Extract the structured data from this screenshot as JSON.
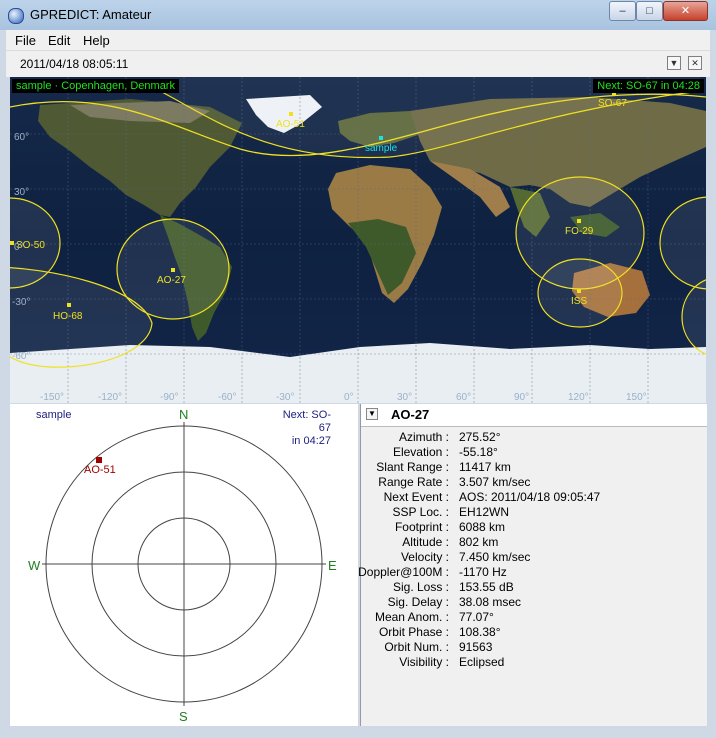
{
  "window": {
    "title": "GPREDICT: Amateur",
    "minimize": "–",
    "maximize": "□",
    "close": "✕"
  },
  "menu": [
    "File",
    "Edit",
    "Help"
  ],
  "timebar": {
    "datetime": "2011/04/18 08:05:11",
    "dropdown": "▼",
    "close": "✕"
  },
  "map": {
    "station_label": "sample · Copenhagen, Denmark",
    "next_label": "Next: SO-67 in 04:28",
    "station_name": "sample",
    "satellites": [
      "AO-51",
      "SO-67",
      "SO-50",
      "AO-27",
      "HO-68",
      "FO-29",
      "ISS"
    ],
    "lat_labels": [
      "60°",
      "30°",
      "0°",
      "-30°",
      "-60°"
    ],
    "lon_labels": [
      "-150°",
      "-120°",
      "-90°",
      "-60°",
      "-30°",
      "0°",
      "30°",
      "60°",
      "90°",
      "120°",
      "150°"
    ]
  },
  "polar": {
    "station": "sample",
    "next_line1": "Next: SO-67",
    "next_line2": "in 04:27",
    "north": "N",
    "south": "S",
    "east": "E",
    "west": "W",
    "sat_label": "AO-51"
  },
  "info": {
    "satellite": "AO-27",
    "rows": [
      {
        "k": "Azimuth :",
        "v": "275.52°"
      },
      {
        "k": "Elevation :",
        "v": "-55.18°"
      },
      {
        "k": "Slant Range :",
        "v": "11417 km"
      },
      {
        "k": "Range Rate :",
        "v": "3.507 km/sec"
      },
      {
        "k": "Next Event :",
        "v": "AOS: 2011/04/18 09:05:47"
      },
      {
        "k": "SSP Loc. :",
        "v": "EH12WN"
      },
      {
        "k": "Footprint :",
        "v": "6088 km"
      },
      {
        "k": "Altitude :",
        "v": "802 km"
      },
      {
        "k": "Velocity :",
        "v": "7.450 km/sec"
      },
      {
        "k": "Doppler@100M :",
        "v": "-1170 Hz"
      },
      {
        "k": "Sig. Loss :",
        "v": "153.55 dB"
      },
      {
        "k": "Sig. Delay :",
        "v": "38.08 msec"
      },
      {
        "k": "Mean Anom. :",
        "v": "77.07°"
      },
      {
        "k": "Orbit Phase :",
        "v": "108.38°"
      },
      {
        "k": "Orbit Num. :",
        "v": "91563"
      },
      {
        "k": "Visibility :",
        "v": "Eclipsed"
      }
    ]
  },
  "colors": {
    "footprint": "#f0e020",
    "station": "#20e0e0",
    "label_green": "#20e020",
    "polar_text": "#208020",
    "sat_marker": "#a00000"
  }
}
